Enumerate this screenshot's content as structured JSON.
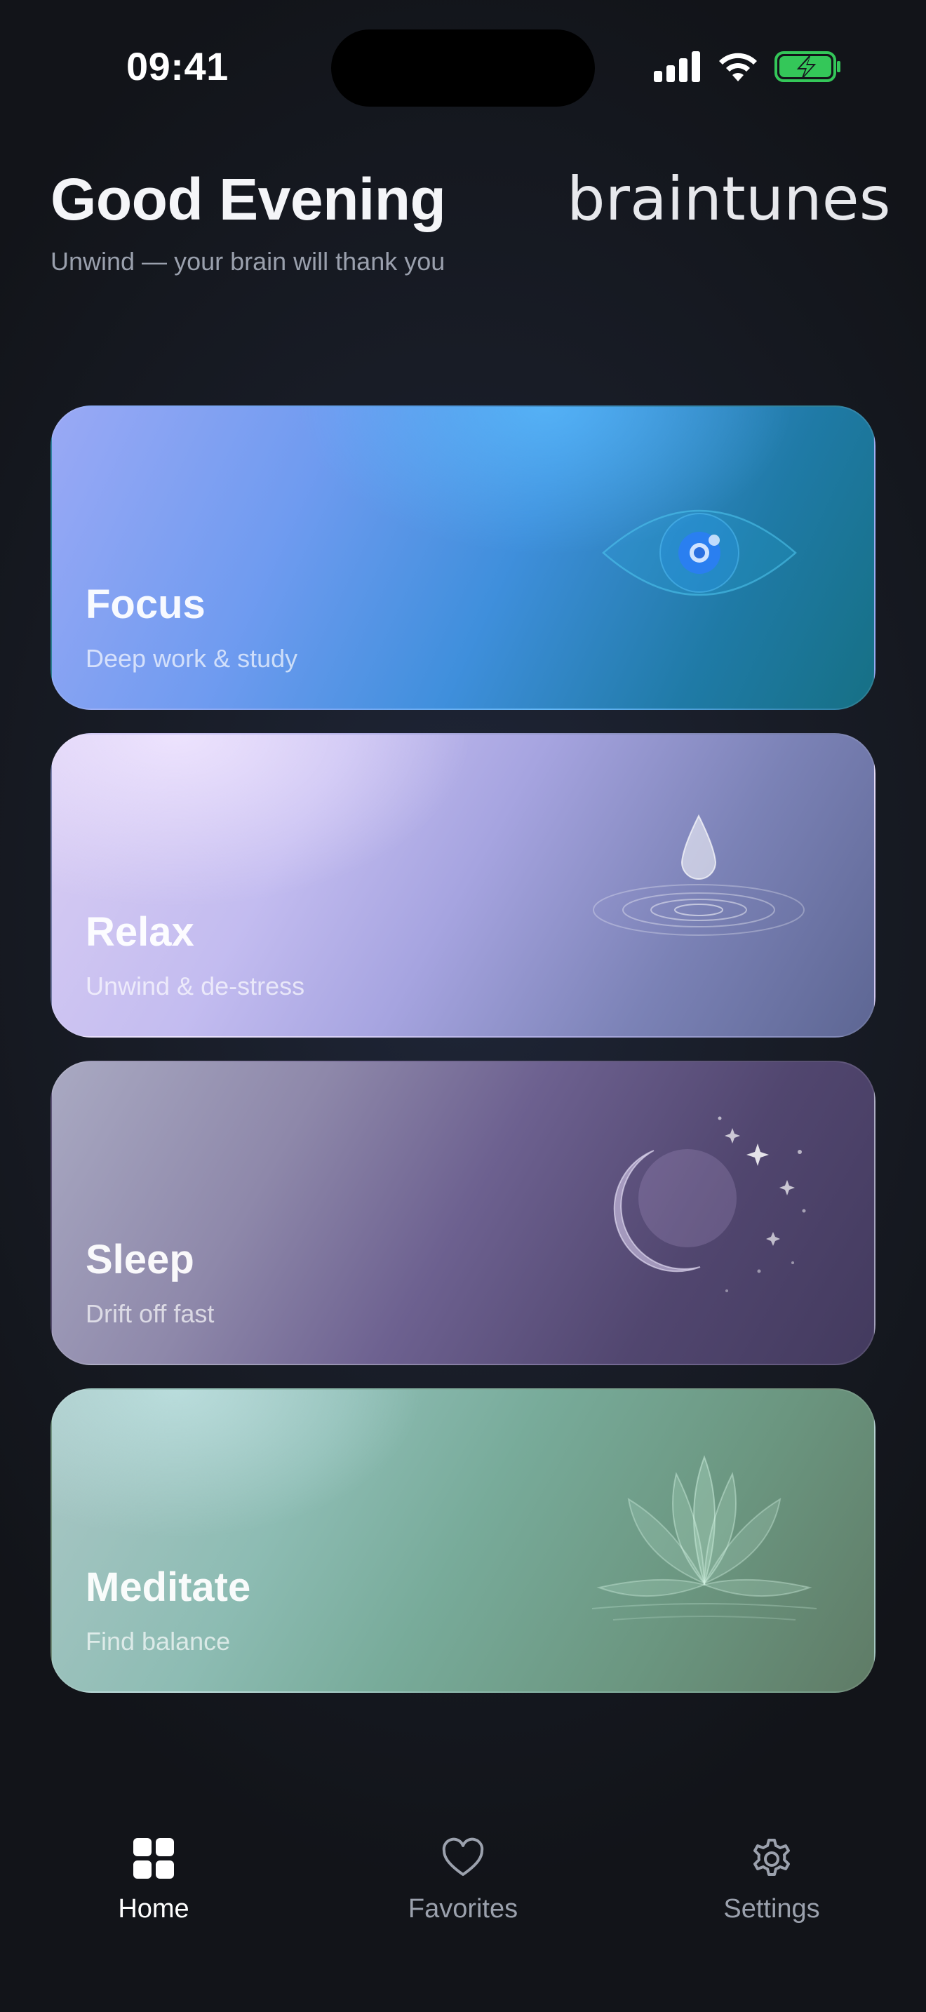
{
  "status_bar": {
    "time": "09:41"
  },
  "header": {
    "greeting": "Good Evening",
    "subtitle": "Unwind — your brain will thank you",
    "logo": "braintunes"
  },
  "cards": [
    {
      "title": "Focus",
      "subtitle": "Deep work & study",
      "icon": "eye-icon"
    },
    {
      "title": "Relax",
      "subtitle": "Unwind & de-stress",
      "icon": "water-drop-icon"
    },
    {
      "title": "Sleep",
      "subtitle": "Drift off fast",
      "icon": "moon-icon"
    },
    {
      "title": "Meditate",
      "subtitle": "Find balance",
      "icon": "lotus-icon"
    }
  ],
  "tabbar": {
    "tabs": [
      {
        "label": "Home",
        "icon": "grid-icon",
        "active": true
      },
      {
        "label": "Favorites",
        "icon": "heart-icon",
        "active": false
      },
      {
        "label": "Settings",
        "icon": "gear-icon",
        "active": false
      }
    ]
  },
  "colors": {
    "background": "#16181f",
    "battery_green": "#34c759",
    "active_tab": "#ffffff",
    "inactive_tab": "#9ba1ad"
  }
}
